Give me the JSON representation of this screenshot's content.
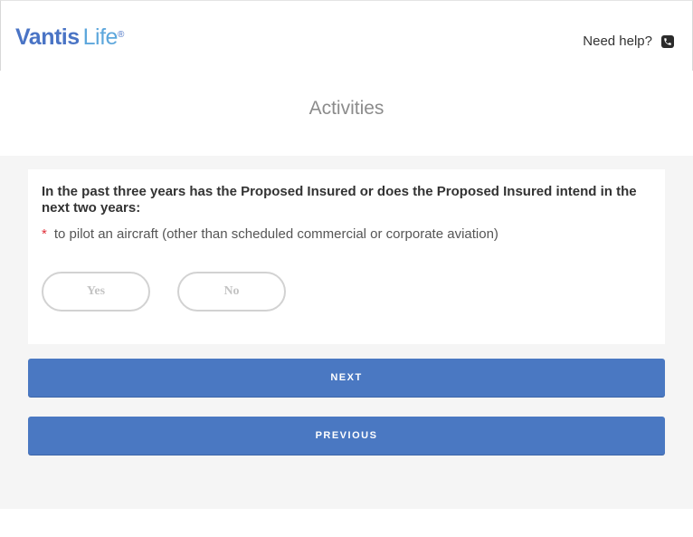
{
  "header": {
    "logo_brand": "Vantis",
    "logo_life": "Life",
    "logo_reg": "®",
    "help_label": "Need help?",
    "help_icon": "phone-icon"
  },
  "page": {
    "title": "Activities"
  },
  "question": {
    "text": "In the past three years has the Proposed Insured or does the Proposed Insured intend in the next two years:",
    "required_marker": "*",
    "item": "to pilot an aircraft (other than scheduled commercial or corporate aviation)",
    "options": [
      "Yes",
      "No"
    ]
  },
  "nav": {
    "next": "NEXT",
    "previous": "PREVIOUS"
  },
  "colors": {
    "primary": "#4a78c2",
    "logo_blue": "#4a74c5",
    "logo_light": "#5da7dc",
    "required": "#e0303a"
  }
}
